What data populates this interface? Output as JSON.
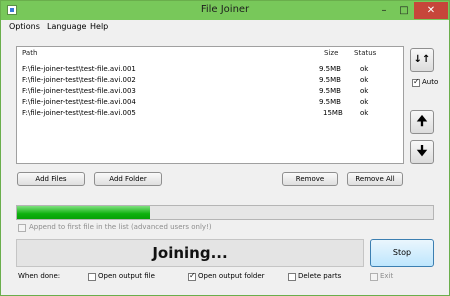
{
  "window": {
    "title": "File Joiner",
    "minimize_glyph": "–",
    "maximize_glyph": "□",
    "close_glyph": "✕"
  },
  "menu": [
    {
      "label": "Options"
    },
    {
      "label": "Language"
    },
    {
      "label": "Help"
    }
  ],
  "list": {
    "headers": {
      "path": "Path",
      "size": "Size",
      "status": "Status"
    },
    "rows": [
      {
        "path": "F:\\file-joiner-test\\test-file.avi.001",
        "size": "9.5MB",
        "status": "ok"
      },
      {
        "path": "F:\\file-joiner-test\\test-file.avi.002",
        "size": "9.5MB",
        "status": "ok"
      },
      {
        "path": "F:\\file-joiner-test\\test-file.avi.003",
        "size": "9.5MB",
        "status": "ok"
      },
      {
        "path": "F:\\file-joiner-test\\test-file.avi.004",
        "size": "9.5MB",
        "status": "ok"
      },
      {
        "path": "F:\\file-joiner-test\\test-file.avi.005",
        "size": "15MB",
        "status": "ok"
      }
    ]
  },
  "side": {
    "sort_icon": "sort-icon",
    "sort_glyph": "↓↑",
    "auto_label": "Auto",
    "auto_checked": true,
    "up_glyph": "🠉",
    "down_glyph": "🠋"
  },
  "buttons": {
    "add_files": "Add Files",
    "add_folder": "Add Folder",
    "remove": "Remove",
    "remove_all": "Remove All",
    "stop": "Stop"
  },
  "progress": {
    "fraction": 0.32
  },
  "append_label": "Append to first file in the list (advanced users only!)",
  "status_text": "Joining...",
  "when_done": {
    "label": "When done:",
    "open_output_file": {
      "label": "Open output file",
      "checked": false
    },
    "open_output_folder": {
      "label": "Open output folder",
      "checked": true
    },
    "delete_parts": {
      "label": "Delete parts",
      "checked": false
    },
    "exit": {
      "label": "Exit",
      "checked": false
    }
  },
  "colors": {
    "accent": "#78c85a",
    "progress": "#0fb10f",
    "close": "#c7463a"
  }
}
